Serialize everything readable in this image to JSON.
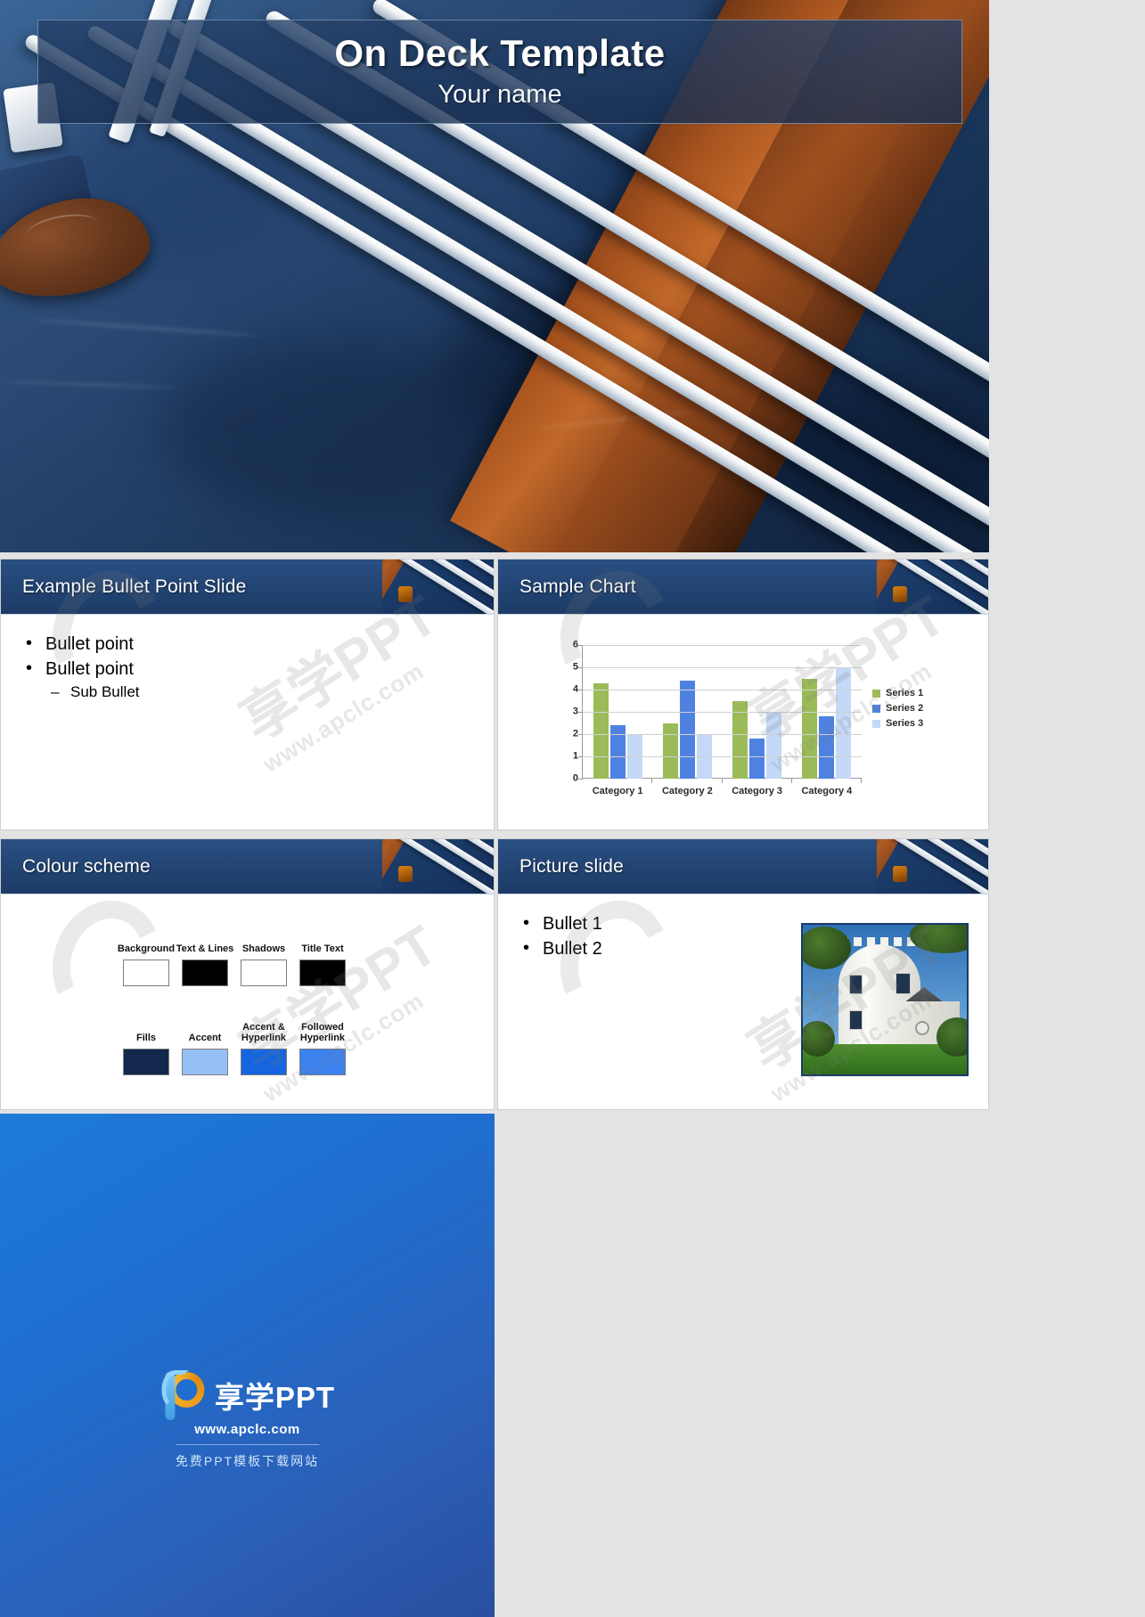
{
  "hero": {
    "title": "On Deck Template",
    "subtitle": "Your name"
  },
  "slides": {
    "bullet": {
      "title": "Example Bullet Point Slide",
      "bullets": [
        "Bullet point",
        "Bullet point"
      ],
      "sub_bullet": "Sub Bullet"
    },
    "chart": {
      "title": "Sample Chart"
    },
    "colour": {
      "title": "Colour scheme",
      "swatches": [
        {
          "label": "Background",
          "color": "#ffffff"
        },
        {
          "label": "Text & Lines",
          "color": "#000000"
        },
        {
          "label": "Shadows",
          "color": "#ffffff"
        },
        {
          "label": "Title Text",
          "color": "#000000"
        },
        {
          "label": "Fills",
          "color": "#12284c"
        },
        {
          "label": "Accent",
          "color": "#96c0f5"
        },
        {
          "label": "Accent & Hyperlink",
          "color": "#1565e0"
        },
        {
          "label": "Followed Hyperlink",
          "color": "#3b82ef"
        }
      ]
    },
    "picture": {
      "title": "Picture slide",
      "bullets": [
        "Bullet 1",
        "Bullet 2"
      ]
    }
  },
  "chart_data": {
    "type": "bar",
    "title": "Sample Chart",
    "categories": [
      "Category 1",
      "Category 2",
      "Category 3",
      "Category 4"
    ],
    "series": [
      {
        "name": "Series 1",
        "values": [
          4.3,
          2.5,
          3.5,
          4.5
        ],
        "color": "#9bbb59"
      },
      {
        "name": "Series 2",
        "values": [
          2.4,
          4.4,
          1.8,
          2.8
        ],
        "color": "#4f81e0"
      },
      {
        "name": "Series 3",
        "values": [
          2.0,
          2.0,
          3.0,
          5.0
        ],
        "color": "#c3d9f7"
      }
    ],
    "yticks": [
      "0",
      "1",
      "2",
      "3",
      "4",
      "5",
      "6"
    ],
    "ylim": [
      0,
      6
    ],
    "xlabel": "",
    "ylabel": "",
    "grid": true,
    "legend_position": "right"
  },
  "footer": {
    "brand": "享学PPT",
    "url": "www.apclc.com",
    "tagline": "免费PPT模板下载网站"
  },
  "watermark": {
    "big": "享学PPT",
    "small": "www.apclc.com"
  }
}
